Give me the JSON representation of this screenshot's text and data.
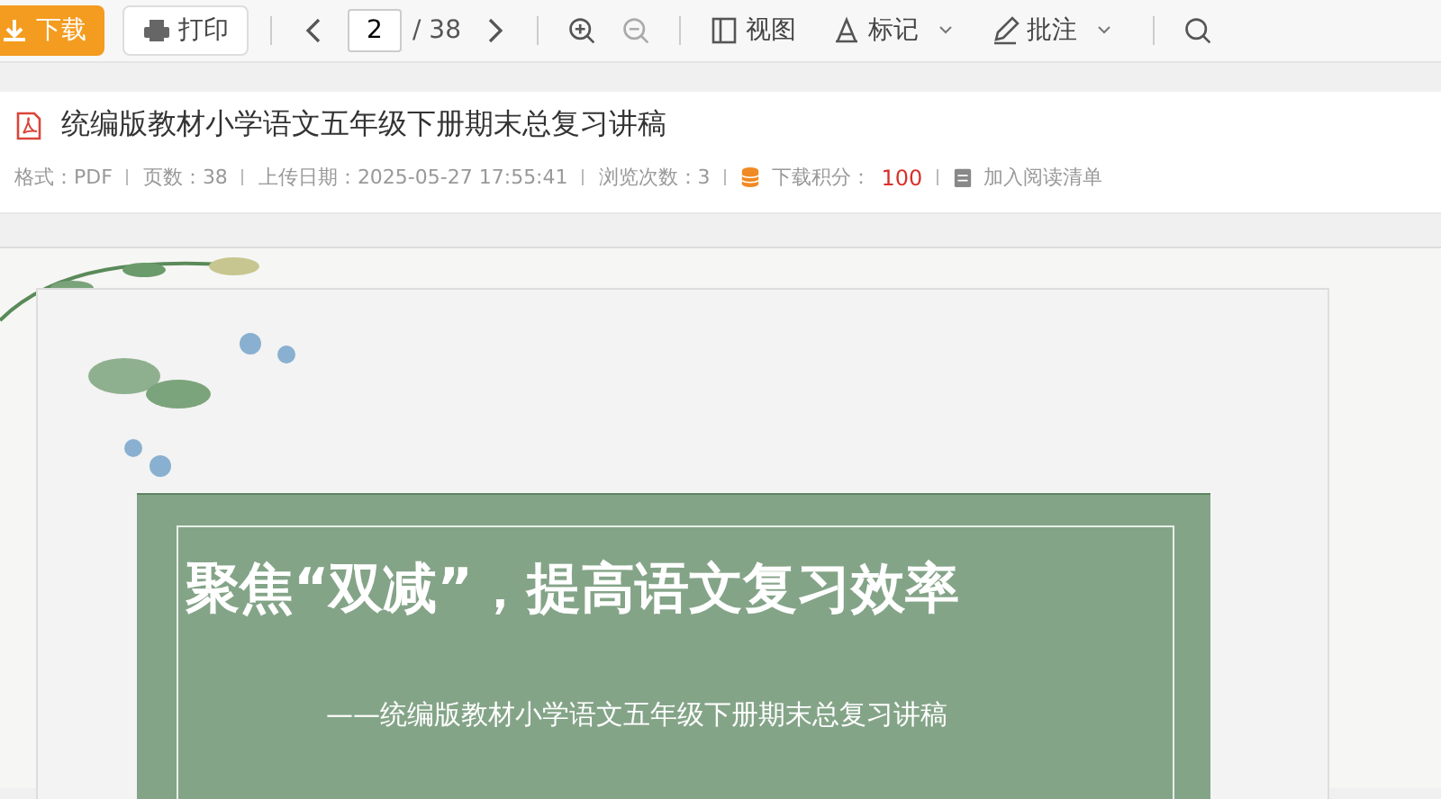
{
  "toolbar": {
    "download": "下载",
    "print": "打印",
    "page": "2",
    "page_total": "/ 38",
    "view": "视图",
    "mark": "标记",
    "annotate": "批注"
  },
  "document": {
    "title": "统编版教材小学语文五年级下册期末总复习讲稿",
    "meta": [
      {
        "kind": "text",
        "label": "格式：",
        "value": "PDF"
      },
      {
        "kind": "text",
        "label": "页数：",
        "value": "38"
      },
      {
        "kind": "text",
        "label": "上传日期：",
        "value": "2025-05-27 17:55:41"
      },
      {
        "kind": "text",
        "label": "浏览次数：",
        "value": "3"
      },
      {
        "kind": "points",
        "label": "下载积分：",
        "value": "100"
      },
      {
        "kind": "link",
        "label": "加入阅读清单"
      }
    ]
  },
  "slide": {
    "heading": "聚焦“双减”，提高语文复习效率",
    "subtitle": "——统编版教材小学语文五年级下册期末总复习讲稿"
  }
}
